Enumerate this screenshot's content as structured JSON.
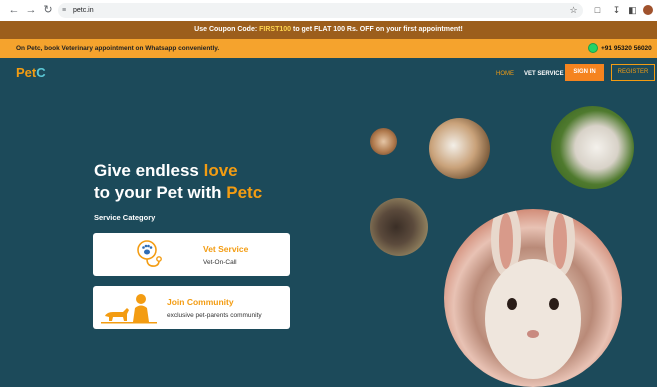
{
  "browser": {
    "url": "petc.in",
    "icons": [
      "back-icon",
      "forward-icon",
      "reload-icon",
      "site-settings-icon",
      "star-icon",
      "extensions-icon",
      "download-icon",
      "sidebar-icon",
      "profile-avatar"
    ]
  },
  "coupon_banner": {
    "prefix": "Use Coupon Code:",
    "code": "FIRST100",
    "suffix": "to get FLAT 100 Rs. OFF on your first appointment!"
  },
  "info_bar": {
    "text": "On Petc, book Veterinary appointment on Whatsapp conveniently.",
    "phone": "+91 95320 56020"
  },
  "header": {
    "logo_main": "Pet",
    "logo_accent": "C",
    "menu": {
      "home": "HOME",
      "vet_services": "VET SERVICE"
    },
    "signin": "SIGN IN",
    "register": "REGISTER"
  },
  "hero": {
    "line1_a": "Give endless",
    "line1_b": "love",
    "line2_a": "to your Pet with",
    "line2_b": "Petc",
    "service_category": "Service Category",
    "cards": [
      {
        "title": "Vet Service",
        "subtitle": "Vet-On-Call",
        "icon": "stethoscope-paw-icon"
      },
      {
        "title": "Join Community",
        "subtitle": "exclusive pet-parents community",
        "icon": "pet-community-icon"
      }
    ]
  },
  "colors": {
    "background": "#1c4a5a",
    "accent_orange": "#f39c12",
    "coupon_bg": "#9c5e1c",
    "info_bg": "#f5a32d"
  }
}
